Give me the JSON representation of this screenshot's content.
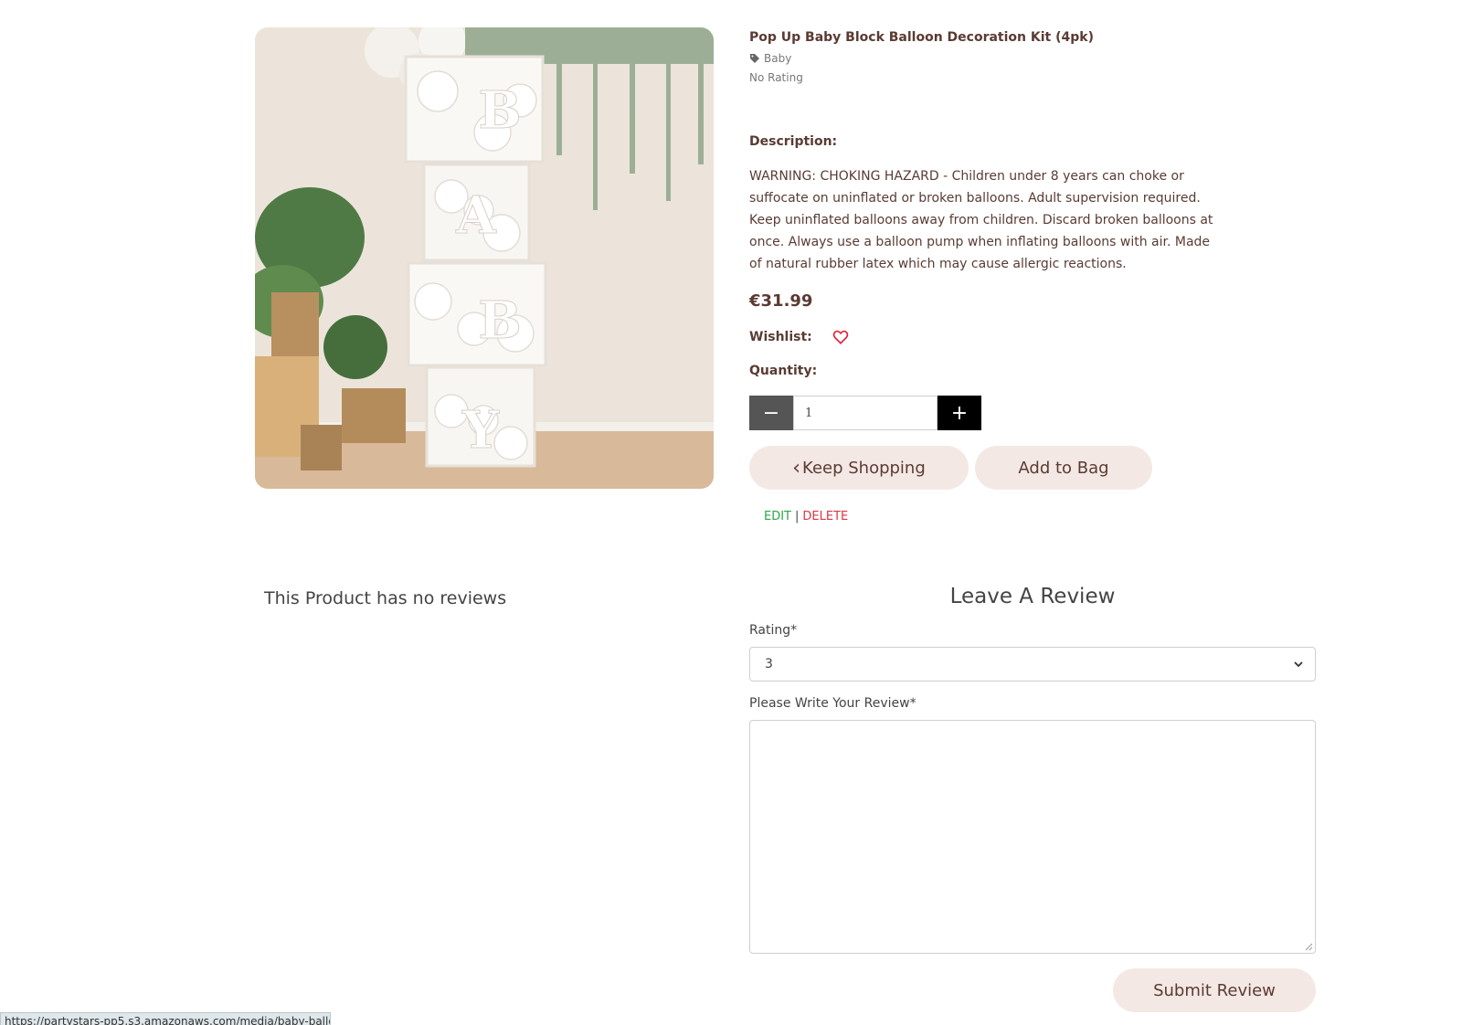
{
  "product": {
    "title": "Pop Up Baby Block Balloon Decoration Kit (4pk)",
    "category_icon": "tag-icon",
    "category": "Baby",
    "rating": "No Rating",
    "description_label": "Description:",
    "description": "WARNING: CHOKING HAZARD - Children under 8 years can choke or suffocate on uninflated or broken balloons. Adult supervision required. Keep uninflated balloons away from children. Discard broken balloons at once. Always use a balloon pump when inflating balloons with air. Made of natural rubber latex which may cause allergic reactions.",
    "price": "€31.99",
    "wishlist_label": "Wishlist:",
    "wishlist_icon": "heart-outline-icon",
    "quantity_label": "Quantity:",
    "quantity_value": "1",
    "minus_label": "−",
    "plus_label": "+",
    "keep_shopping_label": "Keep Shopping",
    "add_to_bag_label": "Add to Bag",
    "edit_label": "EDIT",
    "separator": "|",
    "delete_label": "DELETE",
    "image_letters": [
      "B",
      "A",
      "B",
      "Y"
    ]
  },
  "reviews": {
    "empty_text": "This Product has no reviews",
    "heading": "Leave A Review",
    "rating_label": "Rating*",
    "rating_value": "3",
    "review_label": "Please Write Your Review*",
    "submit_label": "Submit Review"
  },
  "status_bar": {
    "url": "https://partystars-pp5.s3.amazonaws.com/media/baby-ballon2.png"
  },
  "colors": {
    "text": "#5a3b33",
    "pill_bg": "#f4e8e5",
    "heart": "#e0203a",
    "edit": "#28a745",
    "delete": "#dc3545"
  }
}
